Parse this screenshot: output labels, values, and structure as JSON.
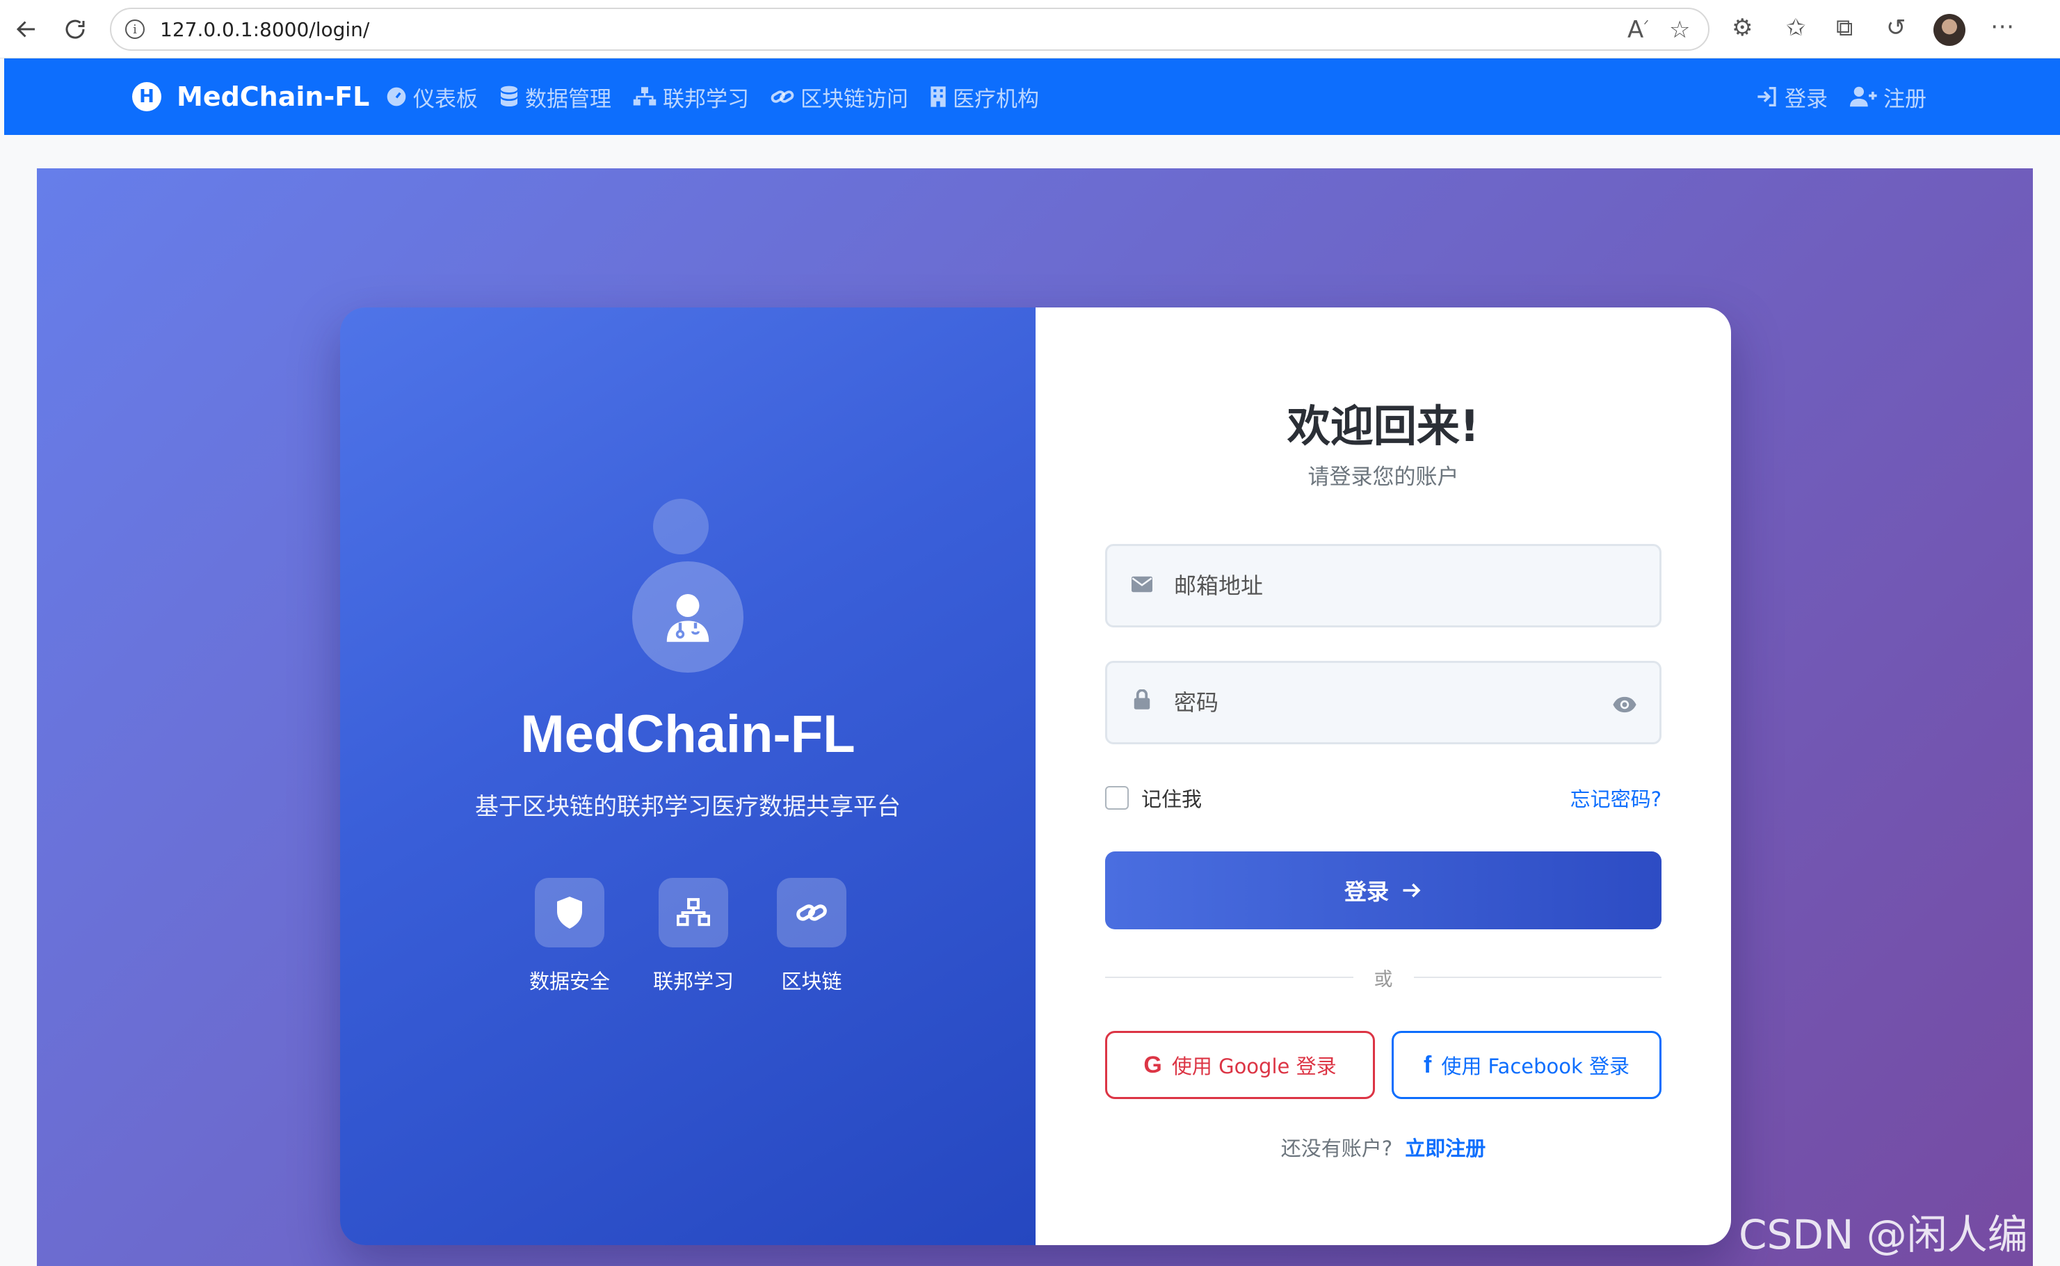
{
  "browser": {
    "url": "127.0.0.1:8000/login/"
  },
  "navbar": {
    "brand_logo_letter": "H",
    "brand_name": "MedChain-FL",
    "links": [
      {
        "label": "仪表板",
        "icon": "gauge-icon"
      },
      {
        "label": "数据管理",
        "icon": "database-icon"
      },
      {
        "label": "联邦学习",
        "icon": "network-icon"
      },
      {
        "label": "区块链访问",
        "icon": "link-icon"
      },
      {
        "label": "医疗机构",
        "icon": "hospital-icon"
      }
    ],
    "login_label": "登录",
    "register_label": "注册"
  },
  "left_panel": {
    "title": "MedChain-FL",
    "subtitle": "基于区块链的联邦学习医疗数据共享平台",
    "features": [
      {
        "label": "数据安全",
        "icon": "shield-icon"
      },
      {
        "label": "联邦学习",
        "icon": "network-icon"
      },
      {
        "label": "区块链",
        "icon": "link-icon"
      }
    ]
  },
  "login_form": {
    "heading": "欢迎回来!",
    "subheading": "请登录您的账户",
    "email_placeholder": "邮箱地址",
    "password_placeholder": "密码",
    "remember_label": "记住我",
    "forgot_label": "忘记密码?",
    "submit_label": "登录",
    "divider_text": "或",
    "google_label": "使用 Google 登录",
    "facebook_label": "使用 Facebook 登录",
    "signup_prompt": "还没有账户?",
    "signup_link": "立即注册"
  },
  "colors": {
    "primary": "#0d6efd",
    "hero_gradient_start": "#667eea",
    "hero_gradient_end": "#764ba2",
    "google": "#dc3545"
  },
  "watermark": "CSDN @闲人编程"
}
